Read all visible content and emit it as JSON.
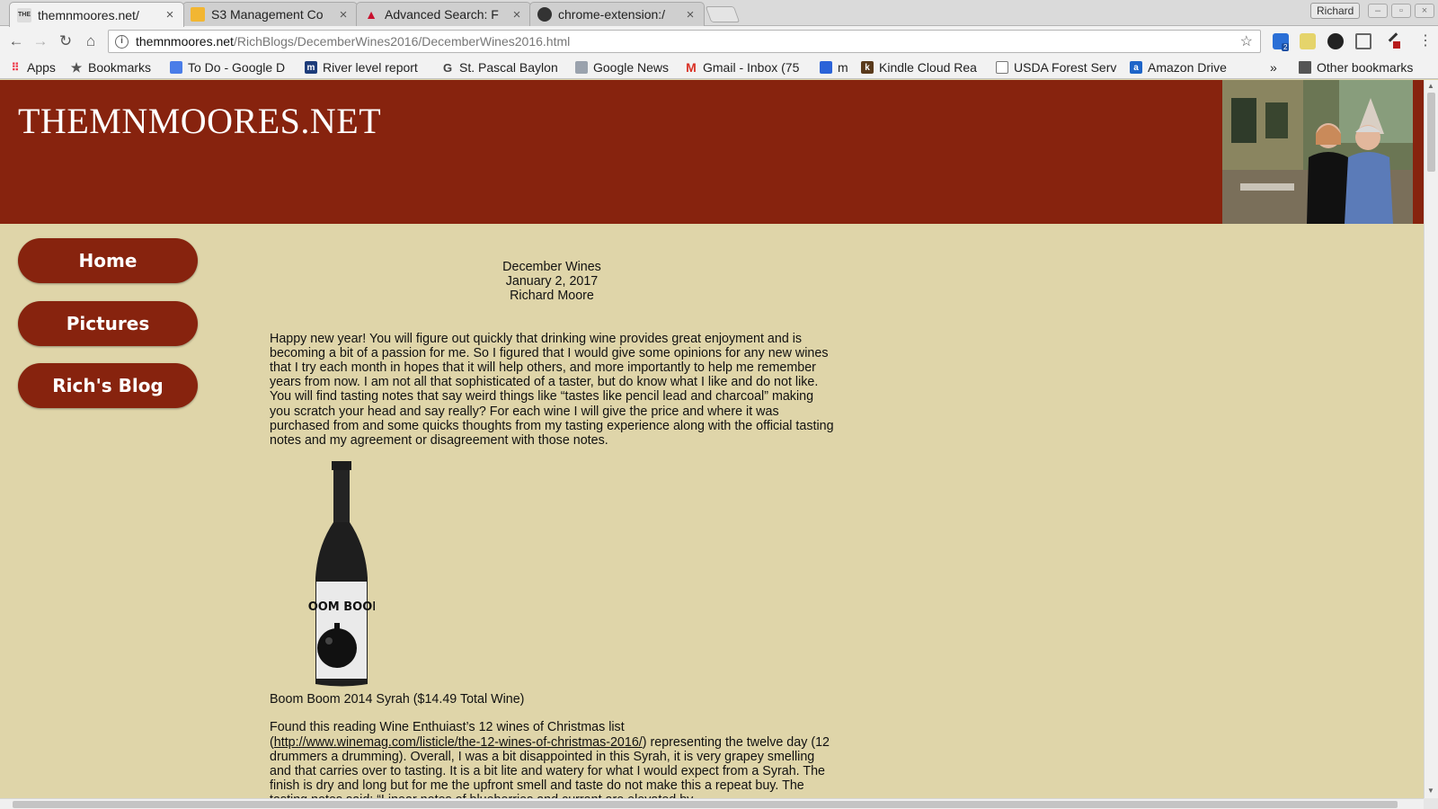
{
  "browser": {
    "tabs": [
      {
        "title": "themnmoores.net/",
        "active": true
      },
      {
        "title": "S3 Management Co",
        "active": false
      },
      {
        "title": "Advanced Search: F",
        "active": false
      },
      {
        "title": "chrome-extension:/",
        "active": false
      }
    ],
    "profile_name": "Richard",
    "address": {
      "host": "themnmoores.net",
      "path": "/RichBlogs/DecemberWines2016/DecemberWines2016.html"
    },
    "bookmarks": [
      {
        "label": "Apps",
        "icon": "apps-grid-icon"
      },
      {
        "label": "Bookmarks",
        "icon": "star-icon"
      },
      {
        "label": "To Do - Google D",
        "icon": "docs-icon"
      },
      {
        "label": "River level report",
        "icon": "mn-icon"
      },
      {
        "label": "St. Pascal Baylon",
        "icon": "google-icon"
      },
      {
        "label": "Google News",
        "icon": "news-icon"
      },
      {
        "label": "Gmail - Inbox (75",
        "icon": "gmail-icon"
      },
      {
        "label": "m",
        "icon": "flag-icon"
      },
      {
        "label": "Kindle Cloud Rea",
        "icon": "kindle-icon"
      },
      {
        "label": "USDA Forest Serv",
        "icon": "page-icon"
      },
      {
        "label": "Amazon Drive",
        "icon": "amazon-icon"
      }
    ],
    "overflow_label": "»",
    "other_bookmarks": "Other bookmarks",
    "extension_badge": "2"
  },
  "site": {
    "title": "THEMNMOORES.NET",
    "nav": [
      {
        "label": "Home"
      },
      {
        "label": "Pictures"
      },
      {
        "label": "Rich's Blog"
      }
    ]
  },
  "post": {
    "title": "December Wines",
    "date": "January 2, 2017",
    "author": "Richard Moore",
    "intro": "Happy new year! You will figure out quickly that drinking wine provides great enjoyment and is becoming a bit of a passion for me. So I figured that I would give some opinions for any new wines that I try each month in hopes that it will help others, and more importantly to help me remember years from now. I am not all that sophisticated of a taster, but do know what I like and do not like. You will find tasting notes that say weird things like “tastes like pencil lead and charcoal” making you scratch your head and say really? For each wine I will give the price and where it was purchased from and some quicks thoughts from my tasting experience along with the official tasting notes and my agreement or disagreement with those notes.",
    "wine_label_text": "BOOM BOOM",
    "wine_caption": "Boom Boom 2014 Syrah ($14.49 Total Wine)",
    "review_before_link": "Found this reading Wine Enthuiast’s 12 wines of Christmas list (",
    "review_link": "http://www.winemag.com/listicle/the-12-wines-of-christmas-2016/",
    "review_after_link": ") representing the twelve day (12 drummers a drumming). Overall, I was a bit disappointed in this Syrah, it is very grapey smelling and that carries over to tasting. It is a bit lite and watery for what I would expect from a Syrah. The finish is dry and long but for me the upfront smell and taste do not make this a repeat buy. The tasting notes said: “Linear notes of blueberries and currant are elevated by"
  },
  "colors": {
    "header_bg": "#87230e",
    "page_bg": "#dfd5a9",
    "nav_bg": "#87230e"
  }
}
